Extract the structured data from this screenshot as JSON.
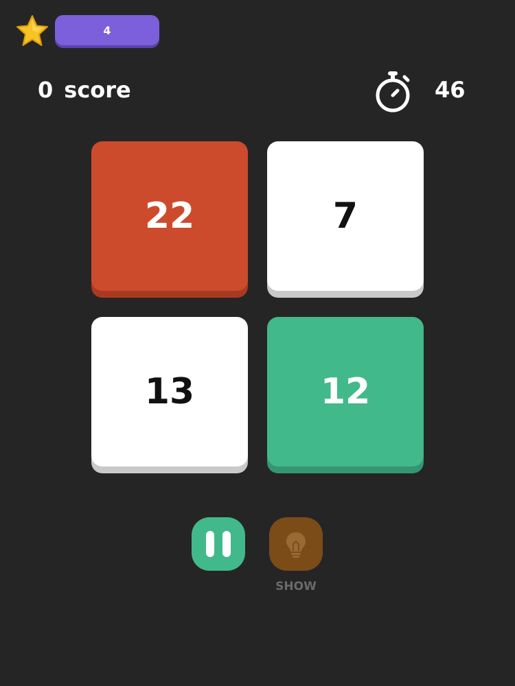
{
  "header": {
    "level_value": "4",
    "score_value": "0",
    "score_label": "score",
    "timer_value": "46"
  },
  "tiles": [
    {
      "value": "22",
      "color": "red"
    },
    {
      "value": "7",
      "color": "white"
    },
    {
      "value": "13",
      "color": "white"
    },
    {
      "value": "12",
      "color": "green"
    }
  ],
  "controls": {
    "hint_label": "SHOW",
    "pause_icon": "pause-icon",
    "hint_icon": "lightbulb-icon"
  },
  "colors": {
    "background": "#262526",
    "level_pill": "#7b5fdb",
    "tile_red": "#cd4b2d",
    "tile_white": "#ffffff",
    "tile_green": "#42b98a",
    "pause_button": "#42b98a",
    "hint_button": "#7b4c18"
  }
}
